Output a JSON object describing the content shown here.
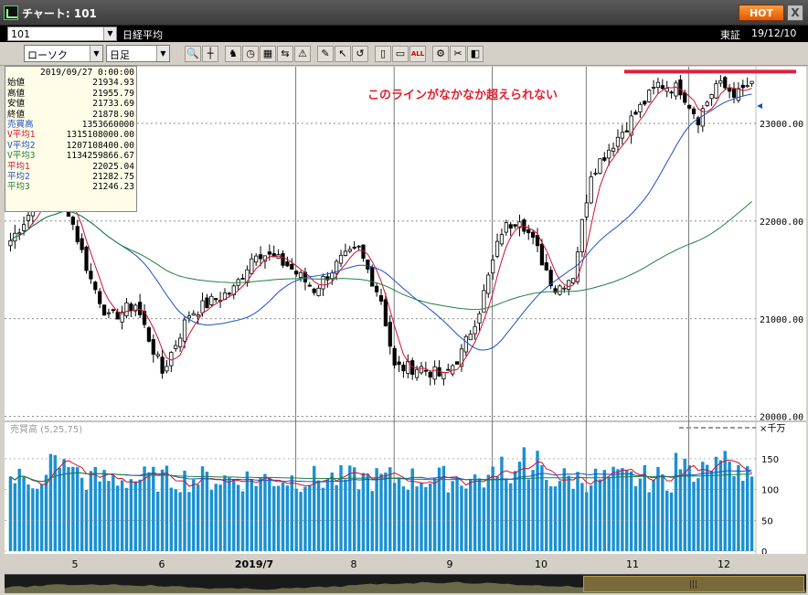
{
  "window": {
    "title": "チャート: 101",
    "hot_label": "HOT",
    "close_label": "X"
  },
  "infobar": {
    "symbol": "101",
    "instrument_name": "日経平均",
    "exchange": "東証",
    "date": "19/12/10"
  },
  "toolbar": {
    "chart_type": "ローソク",
    "period": "日足",
    "icons": [
      "zoom-icon",
      "crosshair-icon",
      "separator",
      "bull-icon",
      "clock-icon",
      "grid-icon",
      "compare-icon",
      "alert-icon",
      "separator",
      "draw-pen-icon",
      "pointer-icon",
      "undo-icon",
      "separator",
      "candle-narrow-icon",
      "candle-wide-icon",
      "all-icon",
      "separator",
      "settings-icon",
      "tool-icon",
      "color-icon"
    ],
    "all_label": "ALL"
  },
  "ohlc_panel": {
    "date": "2019/09/27 0:00:00",
    "rows": [
      {
        "label": "始値",
        "value": "21934.93",
        "color": "#000000"
      },
      {
        "label": "高値",
        "value": "21955.79",
        "color": "#000000"
      },
      {
        "label": "安値",
        "value": "21733.69",
        "color": "#000000"
      },
      {
        "label": "終値",
        "value": "21878.90",
        "color": "#000000"
      },
      {
        "label": "売買高",
        "value": "1353660000",
        "color": "#1a50c8"
      },
      {
        "label": "V平均1",
        "value": "1315108000.00",
        "color": "#d01030"
      },
      {
        "label": "V平均2",
        "value": "1207108400.00",
        "color": "#1a50c8"
      },
      {
        "label": "V平均3",
        "value": "1134259866.67",
        "color": "#208040"
      },
      {
        "label": "平均1",
        "value": "22025.04",
        "color": "#d01030"
      },
      {
        "label": "平均2",
        "value": "21282.75",
        "color": "#1a50c8"
      },
      {
        "label": "平均3",
        "value": "21246.23",
        "color": "#208040"
      }
    ]
  },
  "annotation": "このラインがなかなか超えられない",
  "price_axis": {
    "ticks": [
      "23000.00",
      "22000.00",
      "21000.00",
      "20000.00"
    ]
  },
  "volume_panel": {
    "label": "売買高 (5,25,75)",
    "unit": "×千万",
    "ticks": [
      "150",
      "100",
      "50",
      "0"
    ]
  },
  "x_axis": {
    "labels": [
      "5",
      "6",
      "2019/7",
      "8",
      "9",
      "10",
      "11",
      "12"
    ]
  },
  "colors": {
    "ma_short": "#d01030",
    "ma_mid": "#1a50c8",
    "ma_long": "#208040",
    "volume_bar": "#1a90d0",
    "resistance_line": "#e02040"
  },
  "chart_data": {
    "type": "candlestick",
    "price_range": [
      19950,
      23580
    ],
    "volume_range": [
      0,
      190
    ],
    "resistance_level": 23530,
    "anchors": [
      {
        "i": 0,
        "c": 21800
      },
      {
        "i": 6,
        "c": 22200
      },
      {
        "i": 12,
        "c": 22250
      },
      {
        "i": 18,
        "c": 21400
      },
      {
        "i": 22,
        "c": 21000
      },
      {
        "i": 28,
        "c": 21150
      },
      {
        "i": 34,
        "c": 20450
      },
      {
        "i": 40,
        "c": 21050
      },
      {
        "i": 50,
        "c": 21300
      },
      {
        "i": 55,
        "c": 21700
      },
      {
        "i": 62,
        "c": 21550
      },
      {
        "i": 68,
        "c": 21300
      },
      {
        "i": 74,
        "c": 21600
      },
      {
        "i": 78,
        "c": 21700
      },
      {
        "i": 83,
        "c": 21200
      },
      {
        "i": 86,
        "c": 20500
      },
      {
        "i": 92,
        "c": 20500
      },
      {
        "i": 97,
        "c": 20400
      },
      {
        "i": 101,
        "c": 20650
      },
      {
        "i": 105,
        "c": 21100
      },
      {
        "i": 110,
        "c": 21900
      },
      {
        "i": 114,
        "c": 22050
      },
      {
        "i": 118,
        "c": 21700
      },
      {
        "i": 122,
        "c": 21300
      },
      {
        "i": 126,
        "c": 21450
      },
      {
        "i": 130,
        "c": 22500
      },
      {
        "i": 135,
        "c": 22800
      },
      {
        "i": 140,
        "c": 23100
      },
      {
        "i": 145,
        "c": 23400
      },
      {
        "i": 150,
        "c": 23350
      },
      {
        "i": 154,
        "c": 23050
      },
      {
        "i": 158,
        "c": 23400
      },
      {
        "i": 163,
        "c": 23300
      },
      {
        "i": 166,
        "c": 23430
      }
    ],
    "bar_count": 167,
    "ma_periods": [
      5,
      25,
      75
    ],
    "volume_ma_periods": [
      5,
      25,
      75
    ]
  }
}
